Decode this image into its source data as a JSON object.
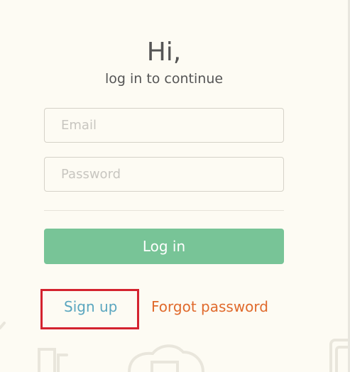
{
  "login": {
    "greeting": "Hi,",
    "subtitle": "log in to continue",
    "email_placeholder": "Email",
    "password_placeholder": "Password",
    "login_button": "Log in",
    "signup_link": "Sign up",
    "forgot_link": "Forgot password"
  },
  "colors": {
    "background": "#fdfbf3",
    "login_button": "#78c497",
    "signup_link": "#5aa6bf",
    "forgot_link": "#e06a2c",
    "highlight": "#d4232f"
  },
  "icons": [
    "background-doodle-icon"
  ]
}
